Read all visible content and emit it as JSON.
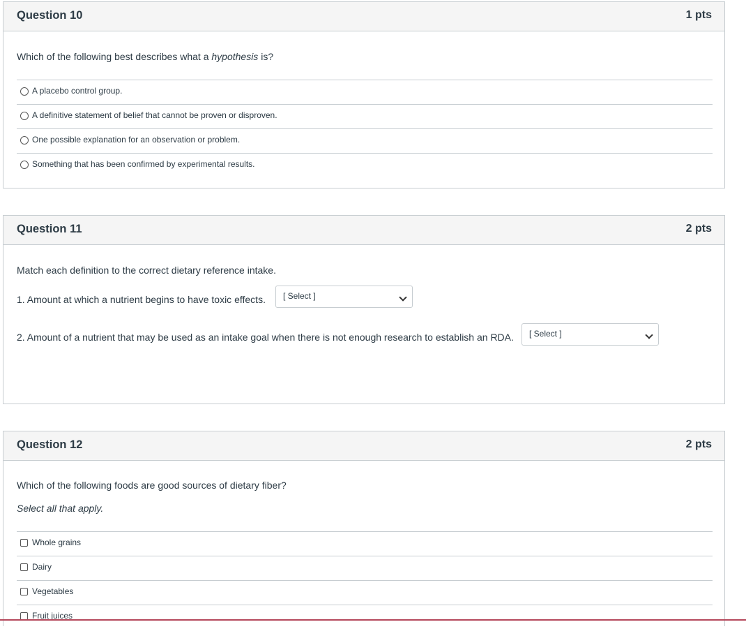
{
  "q10": {
    "title": "Question 10",
    "points": "1 pts",
    "prompt_before": "Which of the following best describes what a ",
    "prompt_italic": "hypothesis",
    "prompt_after": " is?",
    "options": [
      "A placebo control group.",
      "A definitive statement of belief that cannot be proven or disproven.",
      "One possible explanation for an observation or problem.",
      "Something that has been confirmed by experimental results."
    ]
  },
  "q11": {
    "title": "Question 11",
    "points": "2 pts",
    "prompt": "Match each definition to the correct dietary reference intake.",
    "items": [
      {
        "text": "1. Amount at which a nutrient begins to have toxic effects.",
        "select": "[ Select ]"
      },
      {
        "text": "2. Amount of a nutrient that may be used as an intake goal when there is not enough research to establish an RDA.",
        "select": "[ Select ]"
      }
    ]
  },
  "q12": {
    "title": "Question 12",
    "points": "2 pts",
    "prompt": "Which of the following foods are good sources of dietary fiber?",
    "instruction": "Select all that apply.",
    "options": [
      "Whole grains",
      "Dairy",
      "Vegetables",
      "Fruit juices"
    ]
  }
}
